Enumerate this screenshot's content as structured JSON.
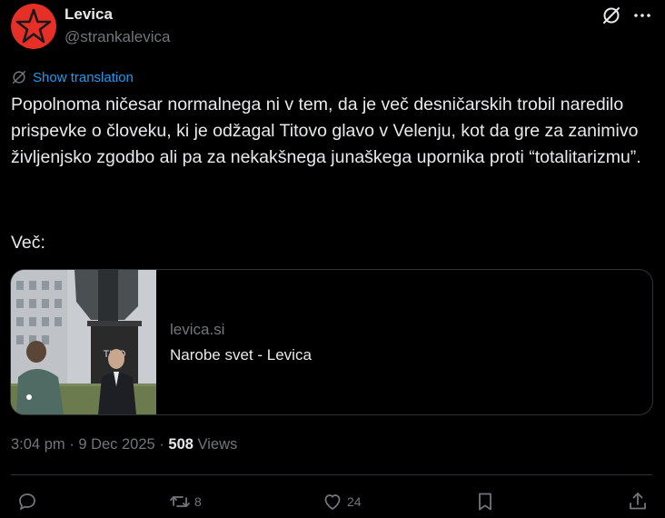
{
  "author": {
    "name": "Levica",
    "handle": "@strankalevica",
    "avatar_icon": "red-star-logo",
    "avatar_color": "#e63027"
  },
  "translate": {
    "label": "Show translation",
    "icon": "translate-globe-icon"
  },
  "tweet": {
    "text": "Popolnoma ničesar normalnega ni v tem, da je več desničarskih trobil naredilo prispevke o človeku, ki je odžagal Titovo glavo v Velenju, kot da gre za zanimivo življenjsko zgodbo ali pa za nekakšnega junaškega upornika proti “totalitarizmu”.",
    "more_label": "Več:"
  },
  "card": {
    "domain": "levica.si",
    "title": "Narobe svet - Levica",
    "thumb_sign_text": "TITO"
  },
  "meta": {
    "time": "3:04 pm",
    "separator": "·",
    "date": "9 Dec 2025",
    "views_count": "508",
    "views_label": "Views"
  },
  "actions": {
    "reply_count": "",
    "repost_count": "8",
    "like_count": "24"
  },
  "colors": {
    "accent": "#1d9bf0",
    "text": "#e7e9ea",
    "muted": "#71767b",
    "border": "#2f3336",
    "background": "#000000"
  }
}
